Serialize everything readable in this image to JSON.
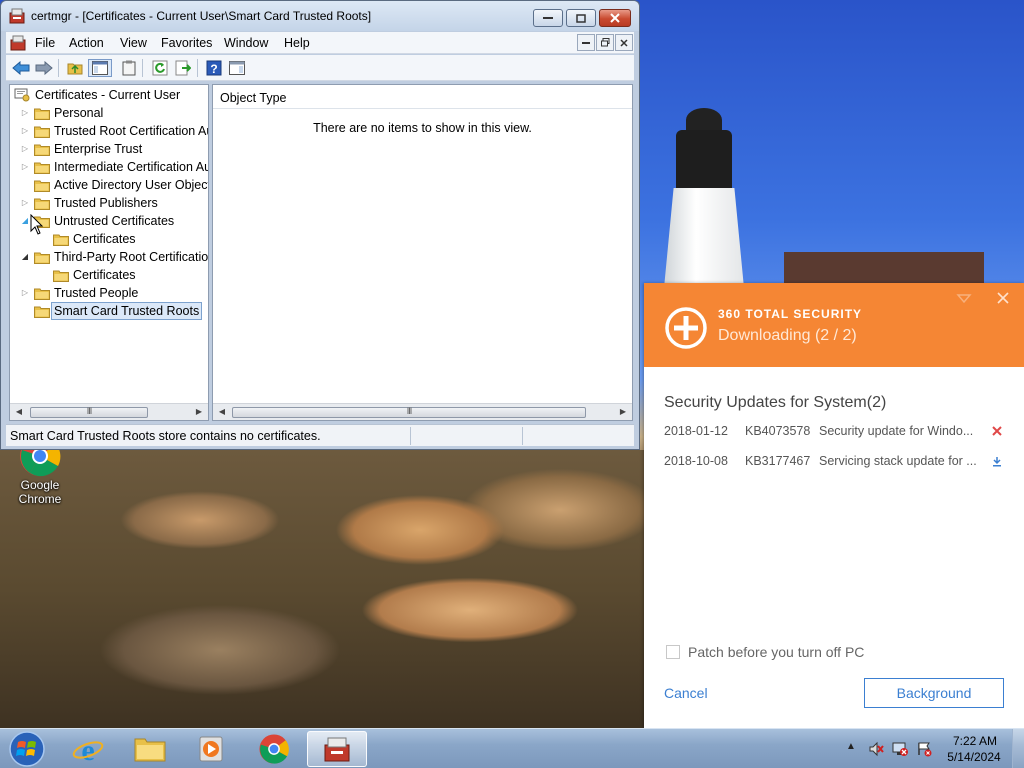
{
  "window": {
    "title": "certmgr - [Certificates - Current User\\Smart Card Trusted Roots]",
    "menu": [
      "File",
      "Action",
      "View",
      "Favorites",
      "Window",
      "Help"
    ]
  },
  "tree": {
    "root": "Certificates - Current User",
    "items": [
      {
        "label": "Personal",
        "arrow": "collapsed",
        "level": 1
      },
      {
        "label": "Trusted Root Certification Au",
        "arrow": "collapsed",
        "level": 1
      },
      {
        "label": "Enterprise Trust",
        "arrow": "collapsed",
        "level": 1
      },
      {
        "label": "Intermediate Certification Au",
        "arrow": "collapsed",
        "level": 1
      },
      {
        "label": "Active Directory User Object",
        "arrow": "none",
        "level": 1
      },
      {
        "label": "Trusted Publishers",
        "arrow": "collapsed",
        "level": 1
      },
      {
        "label": "Untrusted Certificates",
        "arrow": "expanded-hover",
        "level": 1
      },
      {
        "label": "Certificates",
        "arrow": "none",
        "level": 2
      },
      {
        "label": "Third-Party Root Certification",
        "arrow": "expanded",
        "level": 1
      },
      {
        "label": "Certificates",
        "arrow": "none",
        "level": 2
      },
      {
        "label": "Trusted People",
        "arrow": "collapsed",
        "level": 1
      },
      {
        "label": "Smart Card Trusted Roots",
        "arrow": "none",
        "level": 1,
        "selected": true
      }
    ]
  },
  "list": {
    "column_header": "Object Type",
    "empty_message": "There are no items to show in this view."
  },
  "status_bar": {
    "text": "Smart Card Trusted Roots store contains no certificates."
  },
  "desktop": {
    "chrome_label": "Google Chrome"
  },
  "security_panel": {
    "brand": "360 TOTAL SECURITY",
    "status": "Downloading (2 / 2)",
    "section_title": "Security Updates for System(2)",
    "updates": [
      {
        "date": "2018-01-12",
        "kb": "KB4073578",
        "description": "Security update for Windo...",
        "action": "cancel-icon"
      },
      {
        "date": "2018-10-08",
        "kb": "KB3177467",
        "description": "Servicing stack update for ...",
        "action": "download-icon"
      }
    ],
    "patch_label": "Patch before you turn off PC",
    "cancel_label": "Cancel",
    "background_label": "Background",
    "accent_color": "#f58634"
  },
  "taskbar": {
    "time": "7:22 AM",
    "date": "5/14/2024"
  }
}
